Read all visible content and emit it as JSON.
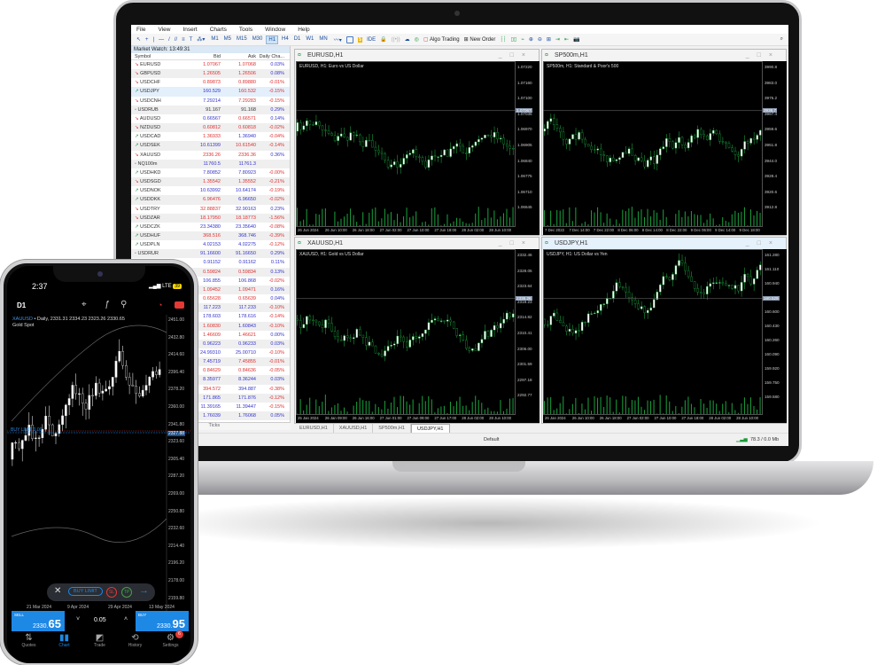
{
  "app": {
    "menu": [
      "File",
      "View",
      "Insert",
      "Charts",
      "Tools",
      "Window",
      "Help"
    ],
    "toolbar": {
      "timeframes": [
        "M1",
        "M5",
        "M15",
        "M30",
        "H1",
        "H4",
        "D1",
        "W1",
        "MN"
      ],
      "active_timeframe": "H1",
      "ide": "IDE",
      "algo_trading": "Algo Trading",
      "new_order": "New Order"
    },
    "market_watch": {
      "title": "Market Watch: 13:49:31",
      "columns": [
        "Symbol",
        "Bid",
        "Ask",
        "Daily Cha..."
      ],
      "selected": "USDJPY",
      "rows": [
        {
          "s": "EURUSD",
          "t": "down",
          "bid": "1.07067",
          "ask": "1.07068",
          "chg": "0.03%",
          "bc": "r",
          "ac": "r"
        },
        {
          "s": "GBPUSD",
          "t": "down",
          "bid": "1.26505",
          "ask": "1.26506",
          "chg": "0.08%",
          "bc": "r",
          "ac": "r"
        },
        {
          "s": "USDCHF",
          "t": "down",
          "bid": "0.89873",
          "ask": "0.89880",
          "chg": "-0.01%",
          "bc": "r",
          "ac": "r"
        },
        {
          "s": "USDJPY",
          "t": "up",
          "bid": "160.529",
          "ask": "160.532",
          "chg": "-0.15%",
          "bc": "b",
          "ac": "r"
        },
        {
          "s": "USDCNH",
          "t": "down",
          "bid": "7.29214",
          "ask": "7.29283",
          "chg": "-0.15%",
          "bc": "b",
          "ac": "r"
        },
        {
          "s": "USDRUB",
          "t": "none",
          "bid": "91.167",
          "ask": "91.168",
          "chg": "0.29%",
          "bc": "k",
          "ac": "k"
        },
        {
          "s": "AUDUSD",
          "t": "down",
          "bid": "0.66567",
          "ask": "0.66571",
          "chg": "0.14%",
          "bc": "b",
          "ac": "r"
        },
        {
          "s": "NZDUSD",
          "t": "down",
          "bid": "0.60812",
          "ask": "0.60818",
          "chg": "-0.02%",
          "bc": "r",
          "ac": "r"
        },
        {
          "s": "USDCAD",
          "t": "up",
          "bid": "1.36933",
          "ask": "1.36940",
          "chg": "-0.04%",
          "bc": "r",
          "ac": "b"
        },
        {
          "s": "USDSEK",
          "t": "up",
          "bid": "10.61399",
          "ask": "10.61540",
          "chg": "-0.14%",
          "bc": "b",
          "ac": "r"
        },
        {
          "s": "XAUUSD",
          "t": "down",
          "bid": "2336.26",
          "ask": "2336.36",
          "chg": "0.36%",
          "bc": "r",
          "ac": "r"
        },
        {
          "s": "NQ100m",
          "t": "none",
          "bid": "11760.5",
          "ask": "11761.3",
          "chg": "",
          "bc": "b",
          "ac": "b"
        },
        {
          "s": "USDHKD",
          "t": "up",
          "bid": "7.80852",
          "ask": "7.80923",
          "chg": "-0.00%",
          "bc": "b",
          "ac": "b"
        },
        {
          "s": "USDSGD",
          "t": "down",
          "bid": "1.35542",
          "ask": "1.35552",
          "chg": "-0.21%",
          "bc": "r",
          "ac": "r"
        },
        {
          "s": "USDNOK",
          "t": "up",
          "bid": "10.63992",
          "ask": "10.64174",
          "chg": "-0.19%",
          "bc": "b",
          "ac": "b"
        },
        {
          "s": "USDDKK",
          "t": "up",
          "bid": "6.96476",
          "ask": "6.96650",
          "chg": "-0.02%",
          "bc": "r",
          "ac": "b"
        },
        {
          "s": "USDTRY",
          "t": "down",
          "bid": "32.88837",
          "ask": "32.90163",
          "chg": "0.23%",
          "bc": "r",
          "ac": "b"
        },
        {
          "s": "USDZAR",
          "t": "down",
          "bid": "18.17950",
          "ask": "18.18773",
          "chg": "-1.56%",
          "bc": "r",
          "ac": "r"
        },
        {
          "s": "USDCZK",
          "t": "up",
          "bid": "23.34380",
          "ask": "23.35640",
          "chg": "-0.08%",
          "bc": "b",
          "ac": "b"
        },
        {
          "s": "USDHUF",
          "t": "up",
          "bid": "368.516",
          "ask": "368.746",
          "chg": "-0.39%",
          "bc": "r",
          "ac": "b"
        },
        {
          "s": "USDPLN",
          "t": "up",
          "bid": "4.02153",
          "ask": "4.02275",
          "chg": "-0.12%",
          "bc": "b",
          "ac": "b"
        },
        {
          "s": "USDRUR",
          "t": "none",
          "bid": "91.16600",
          "ask": "91.16650",
          "chg": "0.29%",
          "bc": "b",
          "ac": "b"
        },
        {
          "s": "",
          "t": "none",
          "bid": "0.91152",
          "ask": "0.91162",
          "chg": "0.11%",
          "bc": "b",
          "ac": "b"
        },
        {
          "s": "",
          "t": "none",
          "bid": "0.59824",
          "ask": "0.59834",
          "chg": "0.13%",
          "bc": "r",
          "ac": "r"
        },
        {
          "s": "",
          "t": "none",
          "bid": "106.855",
          "ask": "106.868",
          "chg": "-0.02%",
          "bc": "b",
          "ac": "b"
        },
        {
          "s": "",
          "t": "none",
          "bid": "1.09452",
          "ask": "1.09471",
          "chg": "0.16%",
          "bc": "r",
          "ac": "r"
        },
        {
          "s": "",
          "t": "none",
          "bid": "0.65628",
          "ask": "0.65639",
          "chg": "0.04%",
          "bc": "r",
          "ac": "r"
        },
        {
          "s": "",
          "t": "none",
          "bid": "117.223",
          "ask": "117.233",
          "chg": "-0.10%",
          "bc": "b",
          "ac": "b"
        },
        {
          "s": "",
          "t": "none",
          "bid": "178.603",
          "ask": "178.616",
          "chg": "-0.14%",
          "bc": "b",
          "ac": "b"
        },
        {
          "s": "",
          "t": "none",
          "bid": "1.60830",
          "ask": "1.60843",
          "chg": "-0.10%",
          "bc": "r",
          "ac": "b"
        },
        {
          "s": "",
          "t": "none",
          "bid": "1.46609",
          "ask": "1.46621",
          "chg": "0.00%",
          "bc": "r",
          "ac": "r"
        },
        {
          "s": "",
          "t": "none",
          "bid": "0.96223",
          "ask": "0.96233",
          "chg": "0.03%",
          "bc": "b",
          "ac": "b"
        },
        {
          "s": "",
          "t": "none",
          "bid": "24.99310",
          "ask": "25.00710",
          "chg": "-0.10%",
          "bc": "b",
          "ac": "b"
        },
        {
          "s": "",
          "t": "none",
          "bid": "7.45719",
          "ask": "7.45855",
          "chg": "-0.01%",
          "bc": "b",
          "ac": "r"
        },
        {
          "s": "",
          "t": "none",
          "bid": "0.84629",
          "ask": "0.84636",
          "chg": "-0.05%",
          "bc": "r",
          "ac": "r"
        },
        {
          "s": "",
          "t": "none",
          "bid": "8.35977",
          "ask": "8.36244",
          "chg": "0.03%",
          "bc": "b",
          "ac": "b"
        },
        {
          "s": "",
          "t": "none",
          "bid": "394.572",
          "ask": "394.887",
          "chg": "-0.38%",
          "bc": "r",
          "ac": "b"
        },
        {
          "s": "",
          "t": "none",
          "bid": "171.865",
          "ask": "171.876",
          "chg": "-0.12%",
          "bc": "b",
          "ac": "b"
        },
        {
          "s": "",
          "t": "none",
          "bid": "11.39165",
          "ask": "11.39447",
          "chg": "-0.15%",
          "bc": "b",
          "ac": "b"
        },
        {
          "s": "",
          "t": "none",
          "bid": "1.76039",
          "ask": "1.76068",
          "chg": "0.05%",
          "bc": "b",
          "ac": "b"
        }
      ],
      "bottom_tabs": [
        "ading",
        "Ticks"
      ]
    },
    "charts": [
      {
        "window_title": "EURUSD,H1",
        "subtitle": "EURUSD, H1:  Euro vs US Dollar",
        "price_label": "1.07067",
        "y_labels": [
          "1.07220",
          "1.07160",
          "1.07100",
          "1.07035",
          "1.06970",
          "1.06905",
          "1.06840",
          "1.06775",
          "1.06710",
          "1.06645"
        ],
        "x_labels": [
          "26 Jun 2024",
          "26 Jun 10:00",
          "26 Jun 18:00",
          "27 Jun 02:00",
          "27 Jun 10:00",
          "27 Jun 18:00",
          "28 Jun 02:00",
          "28 Jun 10:00"
        ]
      },
      {
        "window_title": "SP500m,H1",
        "subtitle": "SP500m, H1:  Standard & Poor's 500",
        "price_label": "3936.7",
        "y_labels": [
          "3990.8",
          "3983.0",
          "3975.2",
          "3967.4",
          "3959.6",
          "3951.8",
          "3944.0",
          "3928.4",
          "3920.6",
          "3912.8"
        ],
        "x_labels": [
          "7 Dec 2022",
          "7 Dec 14:00",
          "7 Dec 22:00",
          "8 Dec 06:00",
          "8 Dec 14:00",
          "8 Dec 22:00",
          "9 Dec 06:00",
          "9 Dec 14:00",
          "9 Dec 18:00"
        ]
      },
      {
        "window_title": "XAUUSD,H1",
        "subtitle": "XAUUSD, H1:  Gold vs US Dollar",
        "price_label": "2336.26",
        "y_labels": [
          "2332.46",
          "2328.05",
          "2323.64",
          "2319.23",
          "2314.82",
          "2310.41",
          "2306.00",
          "2301.59",
          "2297.18",
          "2292.77"
        ],
        "x_labels": [
          "25 Jan 2024",
          "26 Jan 09:00",
          "26 Jun 16:00",
          "27 Jun 01:00",
          "27 Jun 09:00",
          "27 Jun 17:00",
          "28 Jun 02:00",
          "28 Jun 10:00"
        ]
      },
      {
        "window_title": "USDJPY,H1",
        "subtitle": "USDJPY, H1:  US Dollar vs Yen",
        "price_label": "160.529",
        "y_labels": [
          "161.280",
          "161.110",
          "160.940",
          "160.770",
          "160.600",
          "160.430",
          "160.260",
          "160.090",
          "159.920",
          "159.750",
          "159.580"
        ],
        "x_labels": [
          "26 Jan 2024",
          "26 Jun 10:00",
          "26 Jun 18:00",
          "27 Jun 02:00",
          "27 Jun 10:00",
          "27 Jun 18:00",
          "28 Jun 02:00",
          "28 Jun 10:00"
        ]
      }
    ],
    "chart_tabs": [
      "EURUSD,H1",
      "XAUUSD,H1",
      "SP500m,H1",
      "USDJPY,H1"
    ],
    "active_chart_tab": "USDJPY,H1",
    "status": {
      "profile": "Default",
      "traffic": "78.3 / 0.0 Mb"
    }
  },
  "phone": {
    "time": "2:37",
    "network": "LTE",
    "battery": "39",
    "timeframe": "D1",
    "chart_title_symbol": "XAUUSD",
    "chart_title_rest": " • Daily, 2331.31 2334.23 2323.26 2330.65",
    "chart_desc": "Gold Spot",
    "buy_limit_label": "BUY LIMIT 0.00",
    "y_labels": [
      "2451.00",
      "2432.80",
      "2414.60",
      "2396.40",
      "2378.20",
      "2360.00",
      "2341.80",
      "2323.60",
      "2305.40",
      "2287.20",
      "2269.00",
      "2250.80",
      "2232.60",
      "2214.40",
      "2196.20",
      "2178.00",
      "2159.80"
    ],
    "line_price": "2327.88",
    "x_labels": [
      "21 Mar 2024",
      "9 Apr 2024",
      "29 Apr 2024",
      "13 May 2024"
    ],
    "order_bar": {
      "buy_limit": "BUY LIMIT",
      "sl": "SL",
      "tp": "TP"
    },
    "sell": {
      "label": "SELL",
      "price_main": "2330.",
      "price_big": "65"
    },
    "buy": {
      "label": "BUY",
      "price_main": "2330.",
      "price_big": "95"
    },
    "volume": "0.05",
    "nav": [
      {
        "label": "Quotes",
        "icon": "quotes-icon"
      },
      {
        "label": "Chart",
        "icon": "chart-icon"
      },
      {
        "label": "Trade",
        "icon": "trade-icon"
      },
      {
        "label": "History",
        "icon": "history-icon"
      },
      {
        "label": "Settings",
        "icon": "settings-icon"
      }
    ],
    "active_nav": "Chart",
    "settings_badge": "6",
    "colors": {
      "accent": "#1e88e5",
      "bull": "#1a9a3a",
      "bear": "#e03030"
    }
  }
}
